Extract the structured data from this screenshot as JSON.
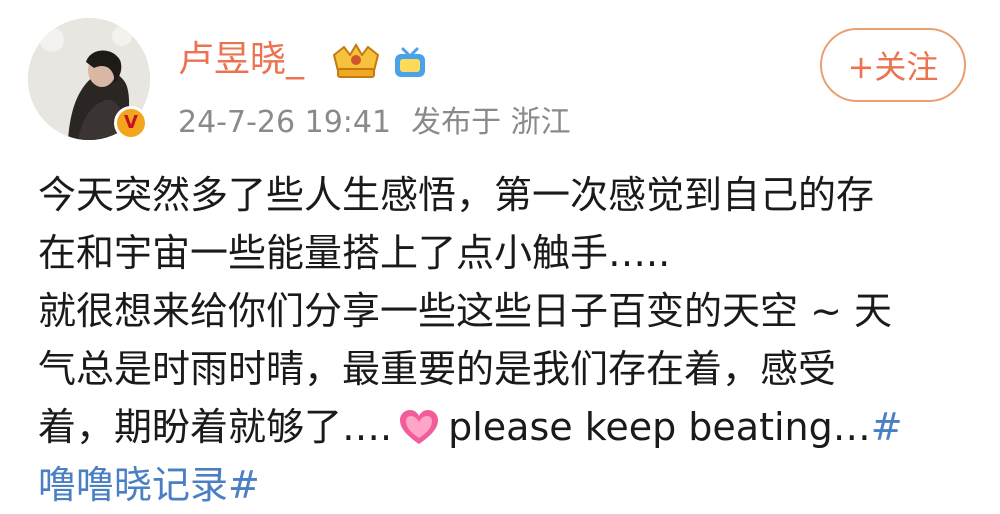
{
  "user": {
    "name": "卢昱晓_",
    "verified_icon": "verified-v-badge",
    "verified_letter": "V",
    "vip_icon": "vip-crown-icon",
    "video_icon": "video-tv-icon",
    "name_color": "#eb7350"
  },
  "post_meta": {
    "timestamp": "24-7-26 19:41",
    "location": "发布于 浙江"
  },
  "follow_button": {
    "label": "+关注"
  },
  "content": {
    "line1": "今天突然多了些人生感悟，第一次感觉到自己的存",
    "line2": "在和宇宙一些能量搭上了点小触手…..",
    "line3": "就很想来给你们分享一些这些日子百变的天空 ~ 天",
    "line4": "气总是时雨时晴，最重要的是我们存在着，感受",
    "line5_before_heart": "着，期盼着就够了….",
    "heart_icon": "pink-heart-icon",
    "line5_after_heart": "please keep beating…",
    "hashtag_part1": "#",
    "hashtag_part2": "噜噜晓记录#"
  },
  "colors": {
    "accent": "#eb7350",
    "meta_gray": "#8a8a8a",
    "hashtag": "#4a7fc4",
    "badge": "#f3a51e"
  }
}
